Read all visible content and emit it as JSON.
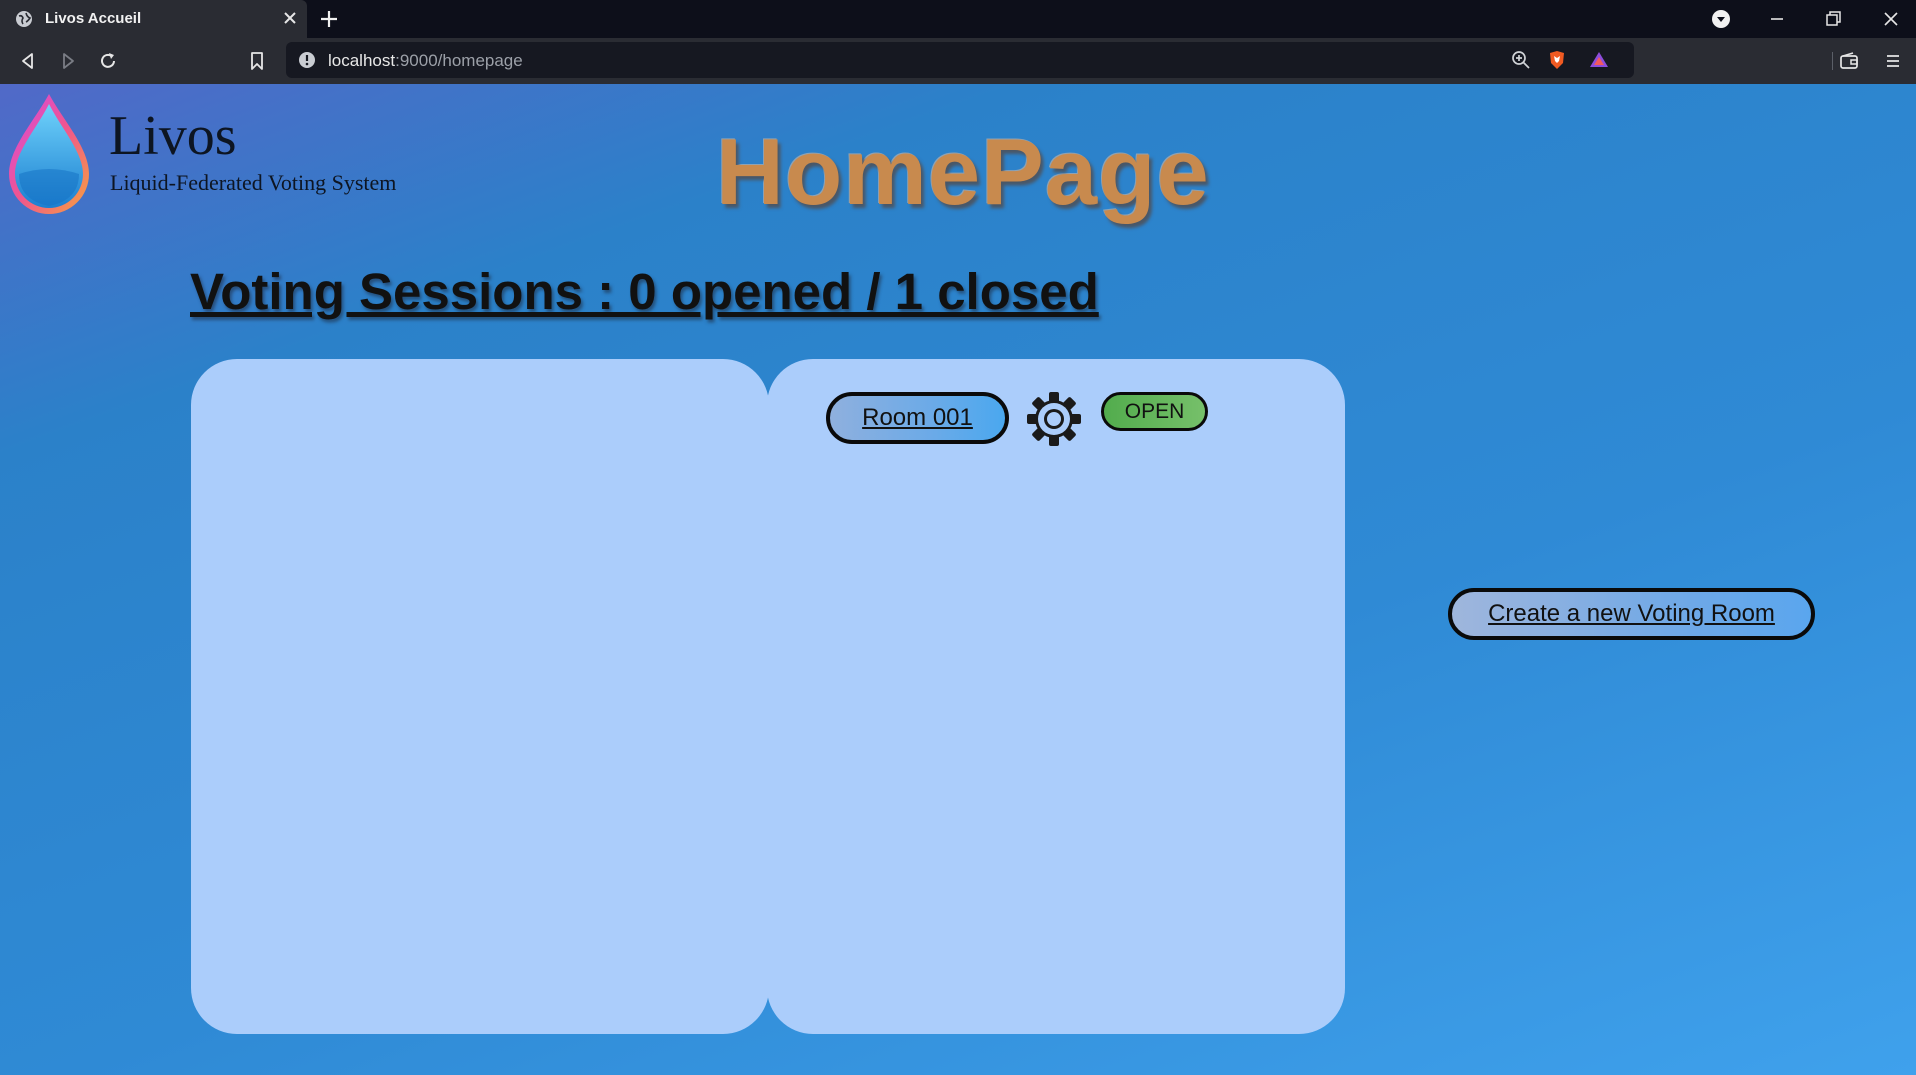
{
  "browser": {
    "tab_title": "Livos Accueil",
    "url_host": "localhost",
    "url_path": ":9000/homepage"
  },
  "header": {
    "brand_name": "Livos",
    "brand_tagline": "Liquid-Federated Voting System",
    "page_title": "HomePage"
  },
  "sessions": {
    "heading": "Voting Sessions : 0 opened / 1 closed"
  },
  "closed_rooms": [
    {
      "name": "Room 001",
      "status": "OPEN",
      "status_color": "#5bb456"
    }
  ],
  "actions": {
    "create_room_label": "Create a new Voting Room"
  },
  "colors": {
    "panel_bg": "#abcdfb",
    "title_color": "#c88a4e",
    "page_bg_start": "#5169c8",
    "page_bg_end": "#3fa1ec"
  }
}
